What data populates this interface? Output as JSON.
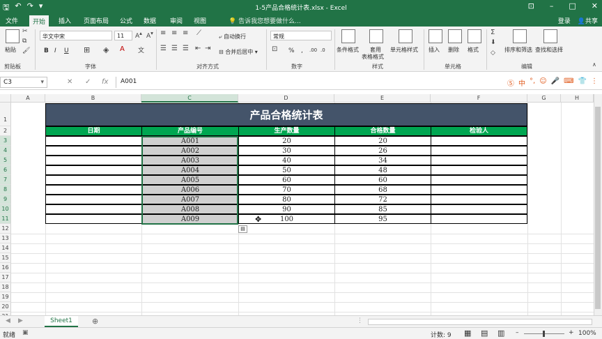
{
  "window": {
    "title": "1-5产品合格统计表.xlsx - Excel",
    "quick_access": [
      "save-icon",
      "undo-icon",
      "redo-icon",
      "customize-icon"
    ],
    "controls": [
      "ribbon-display-icon",
      "minimize-icon",
      "maximize-icon",
      "close-icon"
    ]
  },
  "tabs": [
    "文件",
    "开始",
    "插入",
    "页面布局",
    "公式",
    "数据",
    "审阅",
    "视图"
  ],
  "active_tab": "开始",
  "tell_me": "告诉我您想要做什么...",
  "account": {
    "login": "登录",
    "share": "共享"
  },
  "ribbon": {
    "clipboard": {
      "paste": "粘贴",
      "label": "剪贴板"
    },
    "font": {
      "name": "华文中宋",
      "size": "11",
      "bold": "B",
      "italic": "I",
      "underline": "U",
      "label": "字体"
    },
    "align": {
      "wrap": "自动换行",
      "merge": "合并后居中",
      "label": "对齐方式"
    },
    "number": {
      "format": "常规",
      "percent": "%",
      "comma": ",",
      "label": "数字"
    },
    "styles": {
      "cond": "条件格式",
      "table": "套用",
      "table2": "表格格式",
      "cell": "单元格样式",
      "label": "样式"
    },
    "cells": {
      "insert": "插入",
      "delete": "删除",
      "format": "格式",
      "label": "单元格"
    },
    "editing": {
      "sort": "排序和筛选",
      "find": "查找和选择",
      "label": "编辑"
    }
  },
  "formula_bar": {
    "name_box": "C3",
    "fx": "fx",
    "content": "A001"
  },
  "columns": [
    "A",
    "B",
    "C",
    "D",
    "E",
    "F",
    "G",
    "H"
  ],
  "selected_column": "C",
  "rows": [
    "1",
    "2",
    "3",
    "4",
    "5",
    "6",
    "7",
    "8",
    "9",
    "10",
    "11",
    "12",
    "13",
    "14",
    "15",
    "16",
    "17",
    "18",
    "19",
    "20",
    "21"
  ],
  "sheet": {
    "title": "产品合格统计表",
    "headers": [
      "日期",
      "产品编号",
      "生产数量",
      "合格数量",
      "检验人"
    ],
    "records": [
      {
        "date": "",
        "code": "A001",
        "produced": "20",
        "qualified": "20",
        "inspector": ""
      },
      {
        "date": "",
        "code": "A002",
        "produced": "30",
        "qualified": "26",
        "inspector": ""
      },
      {
        "date": "",
        "code": "A003",
        "produced": "40",
        "qualified": "34",
        "inspector": ""
      },
      {
        "date": "",
        "code": "A004",
        "produced": "50",
        "qualified": "48",
        "inspector": ""
      },
      {
        "date": "",
        "code": "A005",
        "produced": "60",
        "qualified": "60",
        "inspector": ""
      },
      {
        "date": "",
        "code": "A006",
        "produced": "70",
        "qualified": "68",
        "inspector": ""
      },
      {
        "date": "",
        "code": "A007",
        "produced": "80",
        "qualified": "72",
        "inspector": ""
      },
      {
        "date": "",
        "code": "A008",
        "produced": "90",
        "qualified": "85",
        "inspector": ""
      },
      {
        "date": "",
        "code": "A009",
        "produced": "100",
        "qualified": "95",
        "inspector": ""
      }
    ]
  },
  "sheet_tabs": [
    "Sheet1"
  ],
  "status": {
    "mode": "就绪",
    "count": "计数: 9",
    "zoom": "100%"
  },
  "colors": {
    "accent": "#217346",
    "title_fill": "#44546a",
    "header_fill": "#00a651",
    "selected_fill": "#d0d0d0"
  }
}
